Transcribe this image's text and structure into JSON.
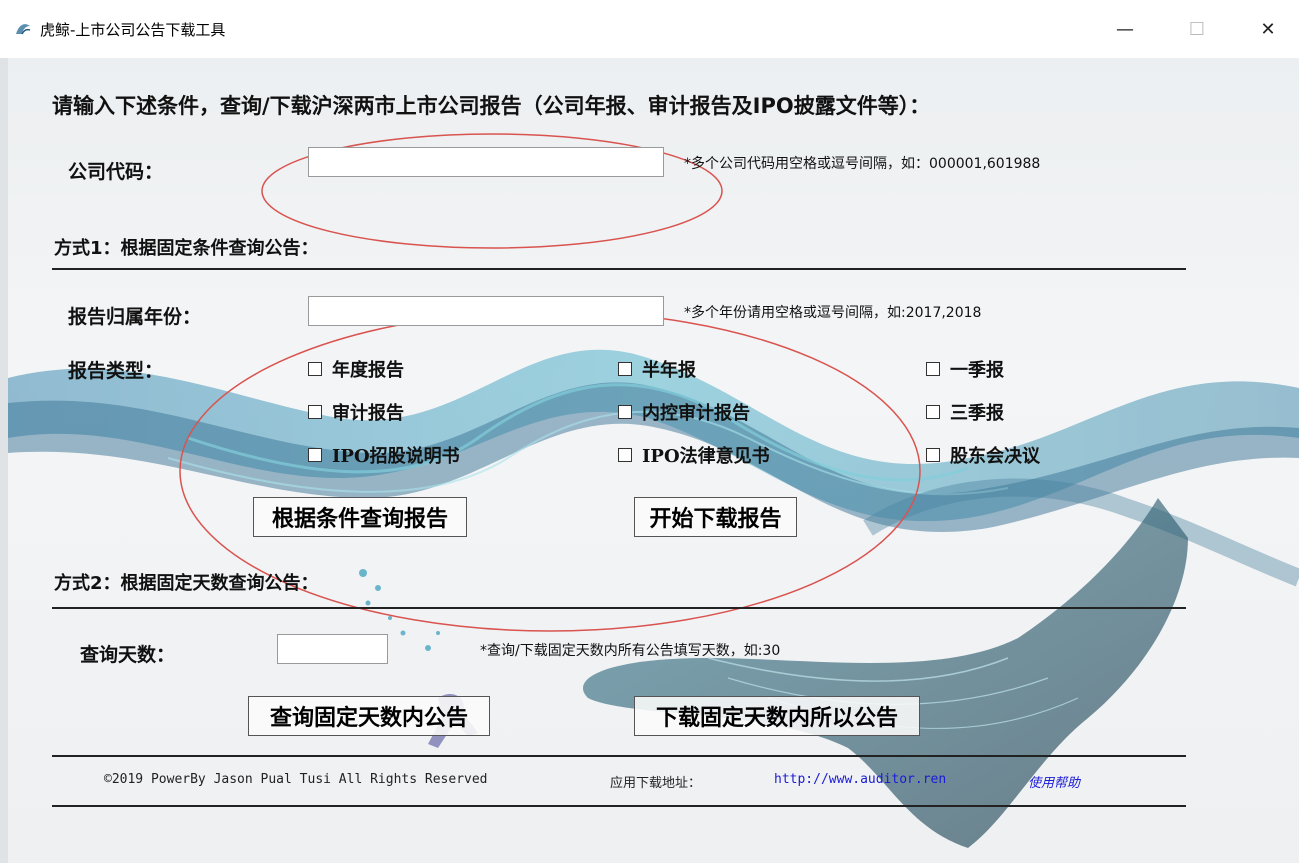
{
  "window": {
    "title": "虎鲸-上市公司公告下载工具",
    "minimize": "—",
    "maximize": "☐",
    "close": "✕"
  },
  "header": "请输入下述条件，查询/下载沪深两市上市公司报告（公司年报、审计报告及IPO披露文件等）：",
  "company": {
    "label": "公司代码：",
    "value": "",
    "hint": "*多个公司代码用空格或逗号间隔，如：000001,601988"
  },
  "mode1": {
    "title": "方式1：根据固定条件查询公告：",
    "year_label": "报告归属年份：",
    "year_value": "",
    "year_hint": "*多个年份请用空格或逗号间隔，如:2017,2018",
    "type_label": "报告类型：",
    "types": [
      "年度报告",
      "半年报",
      "一季报",
      "审计报告",
      "内控审计报告",
      "三季报",
      "IPO招股说明书",
      "IPO法律意见书",
      "股东会决议"
    ],
    "query_button": "根据条件查询报告",
    "download_button": "开始下载报告"
  },
  "mode2": {
    "title": "方式2：根据固定天数查询公告：",
    "days_label": "查询天数：",
    "days_value": "",
    "days_hint": "*查询/下载固定天数内所有公告填写天数，如:30",
    "query_button": "查询固定天数内公告",
    "download_button": "下载固定天数内所以公告"
  },
  "footer": {
    "copyright": "©2019 PowerBy Jason Pual Tusi  All Rights Reserved",
    "download_label": "应用下载地址：",
    "url": "http://www.auditor.ren",
    "help": "使用帮助"
  },
  "colors": {
    "wave_dark": "#1e5f8a",
    "wave_light": "#6fc7d6",
    "annotation_red": "#d9534f",
    "link_blue": "#1b1bd6"
  },
  "icons": [
    "app-icon",
    "minimize-icon",
    "maximize-icon",
    "close-icon",
    "checkbox-icon"
  ]
}
